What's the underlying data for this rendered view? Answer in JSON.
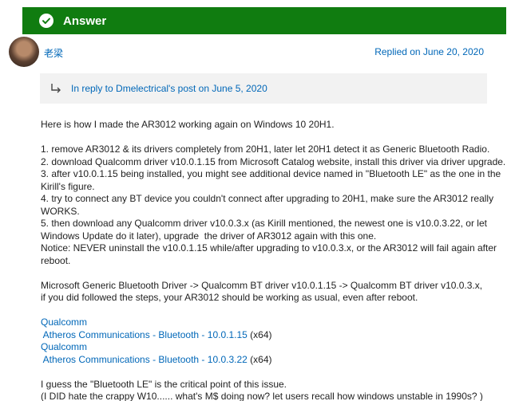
{
  "answer_bar": {
    "label": "Answer"
  },
  "post": {
    "author": "老梁",
    "replied": "Replied on June 20, 2020",
    "reply_to": "In reply to Dmelectrical's post on June 5, 2020"
  },
  "body": {
    "intro": "Here is how I made the AR3012 working again on Windows 10 20H1.",
    "steps": [
      "1. remove AR3012 & its drivers completely from 20H1, later let 20H1 detect it as Generic Bluetooth Radio.",
      "2. download Qualcomm driver v10.0.1.15 from Microsoft Catalog website, install this driver via driver upgrade.",
      "3. after v10.0.1.15 being installed, you might see additional device named in \"Bluetooth LE\" as the one in the",
      "Kirill's figure.",
      "4. try to connect any BT device you couldn't connect after upgrading to 20H1, make sure the AR3012 really",
      "WORKS.",
      "5. then download any Qualcomm driver v10.0.3.x (as Kirill mentioned, the newest one is v10.0.3.22, or let",
      "Windows Update do it later), upgrade  the driver of AR3012 again with this one.",
      "Notice: NEVER uninstall the v10.0.1.15 while/after upgrading to v10.0.3.x, or the AR3012 will fail again after",
      "reboot."
    ],
    "summary": [
      "Microsoft Generic Bluetooth Driver -> Qualcomm BT driver v10.0.1.15 -> Qualcomm BT driver v10.0.3.x,",
      "if you did followed the steps, your AR3012 should be working as usual, even after reboot."
    ],
    "links": [
      {
        "vendor": "Qualcomm",
        "driver": " Atheros Communications - Bluetooth - 10.0.1.15",
        "arch": " (x64)"
      },
      {
        "vendor": "Qualcomm",
        "driver": " Atheros Communications - Bluetooth - 10.0.3.22",
        "arch": " (x64)"
      }
    ],
    "closing": [
      "I guess the \"Bluetooth LE\" is the critical point of this issue.",
      "(I DID hate the crappy W10...... what's M$ doing now? let users recall how windows unstable in 1990s? )"
    ]
  }
}
